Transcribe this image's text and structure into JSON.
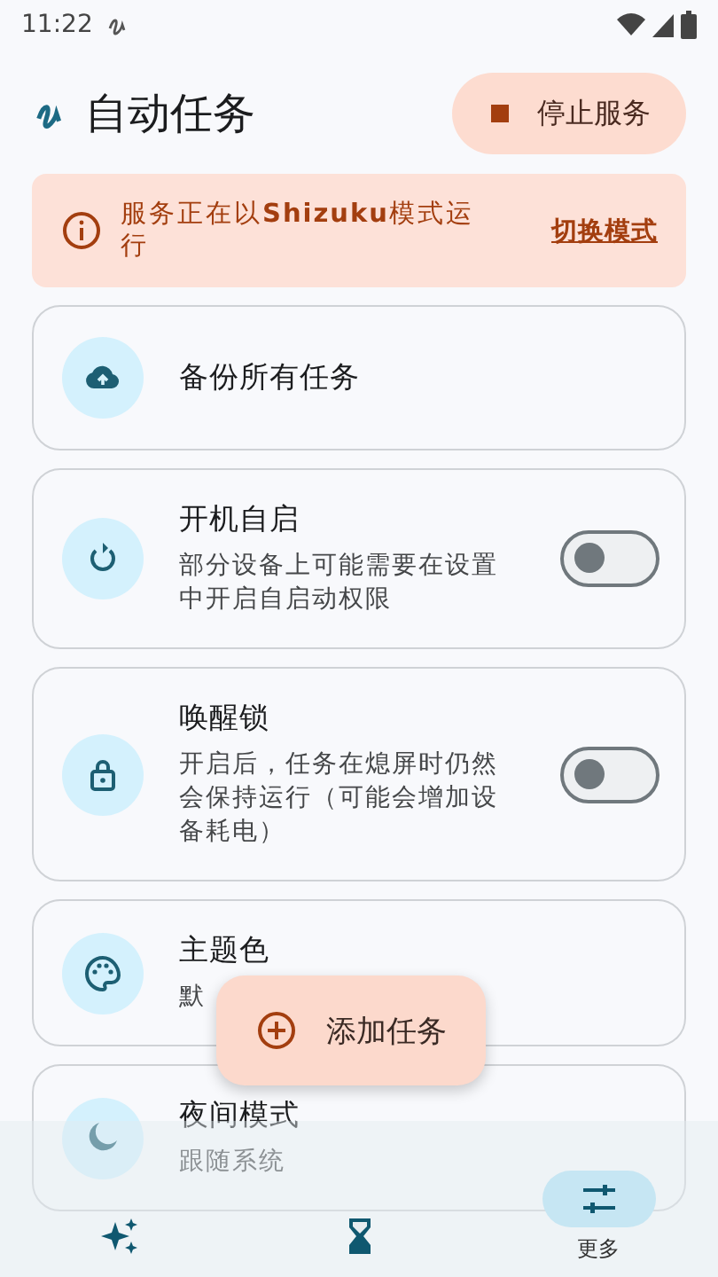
{
  "status_bar": {
    "time": "11:22"
  },
  "header": {
    "title": "自动任务",
    "stop_button": "停止服务"
  },
  "banner": {
    "message": "服务正在以**Shizuku**模式运行",
    "link": "切换模式"
  },
  "cards": [
    {
      "kind": "action",
      "title": "备份所有任务"
    },
    {
      "kind": "toggle",
      "title": "开机自启",
      "subtitle": "部分设备上可能需要在设置中开启自启动权限",
      "on": false
    },
    {
      "kind": "toggle",
      "title": "唤醒锁",
      "subtitle": "开启后，任务在熄屏时仍然会保持运行（可能会增加设备耗电）",
      "on": false
    },
    {
      "kind": "option",
      "title": "主题色",
      "subtitle": "默"
    },
    {
      "kind": "option",
      "title": "夜间模式",
      "subtitle": "跟随系统"
    }
  ],
  "fab": {
    "label": "添加任务"
  },
  "bottom_nav": [
    {
      "selected": false
    },
    {
      "selected": false
    },
    {
      "label": "更多",
      "selected": true
    }
  ]
}
